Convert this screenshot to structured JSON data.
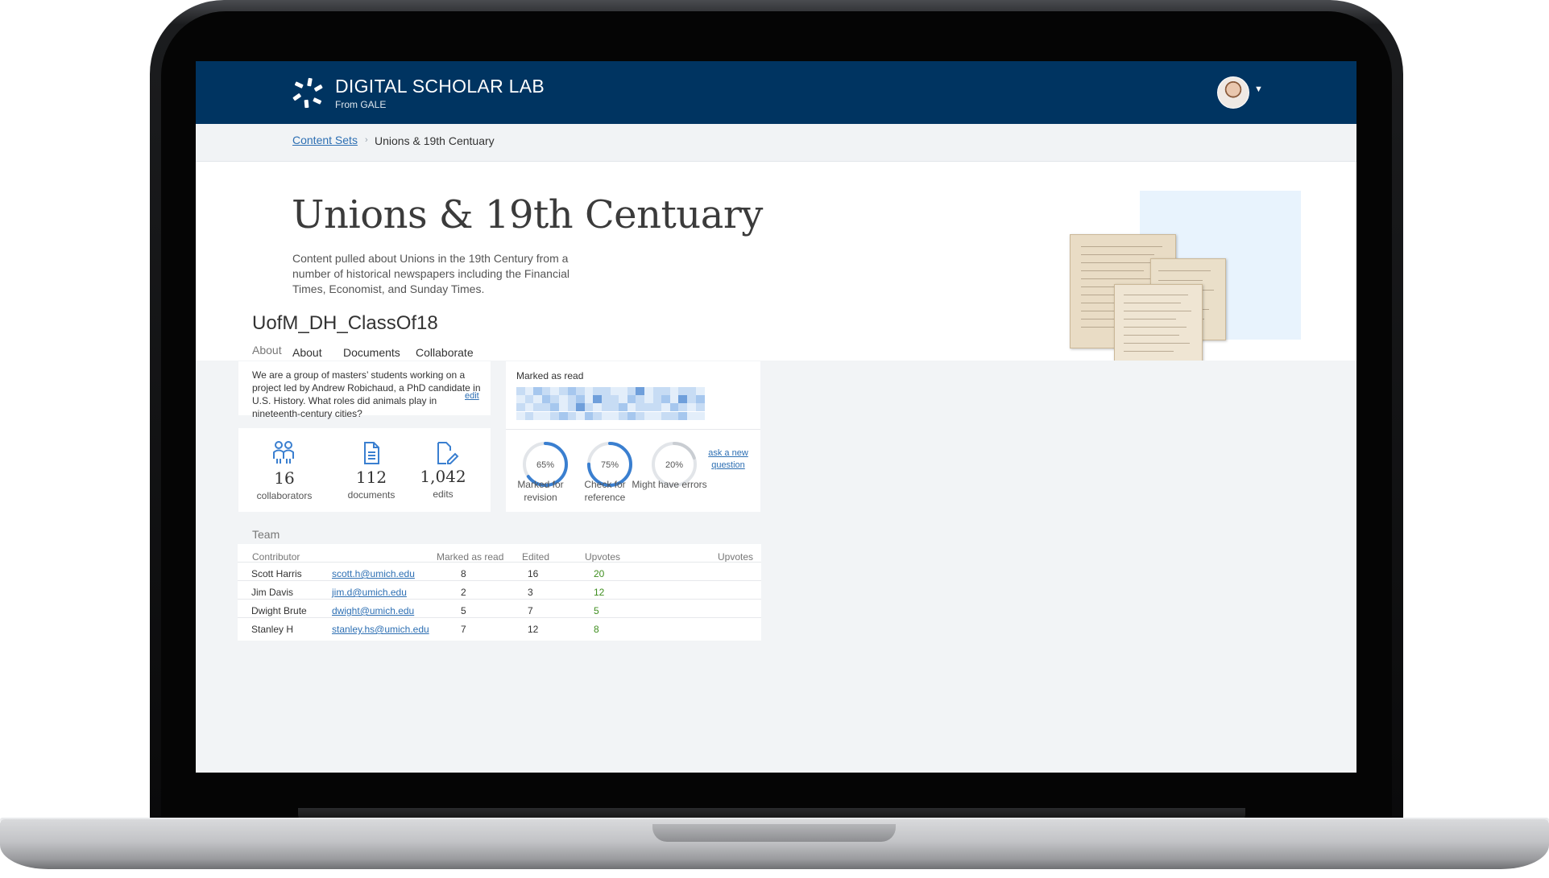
{
  "brand": {
    "title": "DIGITAL SCHOLAR LAB",
    "subtitle": "From GALE"
  },
  "breadcrumb": {
    "link": "Content Sets",
    "separator": "›",
    "current": "Unions & 19th Centuary"
  },
  "page": {
    "title": "Unions & 19th Centuary",
    "description": "Content pulled about Unions in the 19th Century from a number of historical newspapers including the Financial Times, Economist, and Sunday Times."
  },
  "tabs": [
    {
      "label": "About",
      "active": false
    },
    {
      "label": "Documents",
      "active": false
    },
    {
      "label": "Collaborate",
      "active": true
    }
  ],
  "group": {
    "name": "UofM_DH_ClassOf18",
    "about_label": "About",
    "about_text": "We are a group of masters’ students working on a project led by Andrew Robichaud, a PhD candidate in U.S. History. What roles did animals play in nineteenth-century cities?",
    "edit_label": "edit"
  },
  "stats": [
    {
      "value": "16",
      "label": "collaborators",
      "icon": "people-icon"
    },
    {
      "value": "112",
      "label": "documents",
      "icon": "document-icon"
    },
    {
      "value": "1,042",
      "label": "edits",
      "icon": "edit-icon"
    }
  ],
  "marked_as_read": {
    "title": "Marked as read",
    "palette": [
      "#e3eefa",
      "#c7dcf4",
      "#a6c7ee",
      "#6f9fdb"
    ],
    "grid": [
      [
        1,
        0,
        2,
        1,
        0,
        1,
        2,
        1,
        0,
        1,
        1,
        0,
        0,
        1,
        3,
        0,
        1,
        1,
        0,
        1,
        1,
        0
      ],
      [
        0,
        1,
        0,
        2,
        1,
        0,
        1,
        2,
        0,
        3,
        1,
        1,
        0,
        2,
        1,
        0,
        1,
        2,
        0,
        3,
        1,
        2
      ],
      [
        1,
        0,
        1,
        1,
        2,
        0,
        1,
        3,
        1,
        0,
        1,
        1,
        2,
        0,
        1,
        1,
        1,
        0,
        2,
        1,
        0,
        1
      ],
      [
        0,
        1,
        0,
        0,
        1,
        2,
        1,
        0,
        2,
        1,
        0,
        0,
        1,
        2,
        1,
        0,
        0,
        1,
        1,
        2,
        0,
        0
      ]
    ]
  },
  "metrics": [
    {
      "percent": 65,
      "text": "65%",
      "label": "Marked for revision",
      "color": "#3a7fd0"
    },
    {
      "percent": 75,
      "text": "75%",
      "label": "Check for reference",
      "color": "#3a7fd0"
    },
    {
      "percent": 20,
      "text": "20%",
      "label": "Might have errors",
      "color": "#c9cdd2"
    }
  ],
  "ask_link": "ask a new question",
  "team": {
    "label": "Team",
    "headers": [
      "Contributor",
      "Marked as read",
      "Edited",
      "Upvotes",
      "Upvotes"
    ],
    "rows": [
      {
        "name": "Scott Harris",
        "email": "scott.h@umich.edu",
        "read": "8",
        "edited": "16",
        "upvotes": "20"
      },
      {
        "name": "Jim Davis",
        "email": "jim.d@umich.edu",
        "read": "2",
        "edited": "3",
        "upvotes": "12"
      },
      {
        "name": "Dwight Brute",
        "email": "dwight@umich.edu",
        "read": "5",
        "edited": "7",
        "upvotes": "5"
      },
      {
        "name": "Stanley H",
        "email": "stanley.hs@umich.edu",
        "read": "7",
        "edited": "12",
        "upvotes": "8"
      }
    ]
  },
  "avatar": {
    "icon": "user-avatar"
  }
}
